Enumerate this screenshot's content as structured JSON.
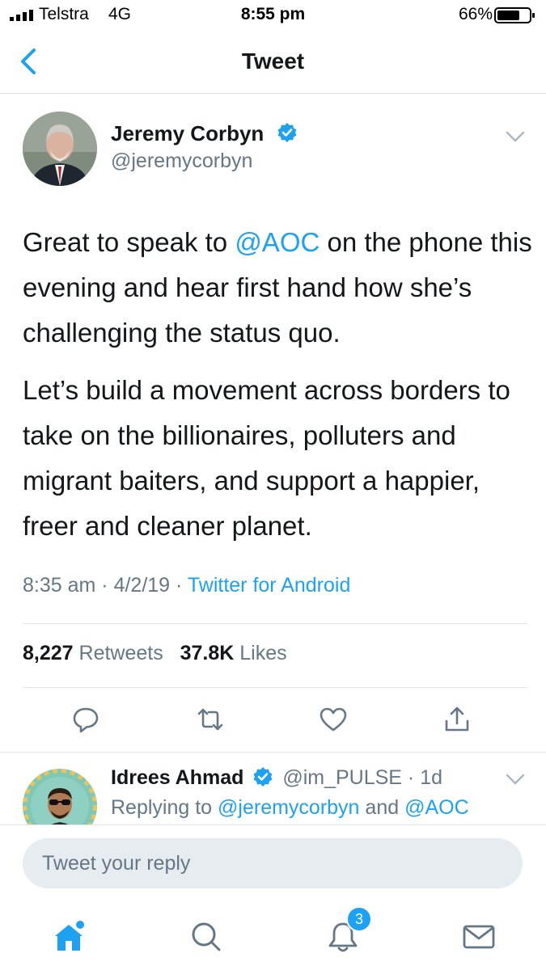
{
  "status_bar": {
    "carrier": "Telstra",
    "network": "4G",
    "time": "8:55 pm",
    "battery": "66%"
  },
  "header": {
    "title": "Tweet"
  },
  "tweet": {
    "author_name": "Jeremy Corbyn",
    "handle": "@jeremycorbyn",
    "paragraph1": {
      "before": "Great to speak to ",
      "mention": "@AOC",
      "after": " on the phone this evening and hear first hand how she’s challenging the status quo."
    },
    "paragraph2": "Let’s build a movement across borders to take on the billionaires, polluters and migrant baiters, and support a happier, freer and cleaner planet.",
    "time": "8:35 am",
    "date": "4/2/19",
    "source": "Twitter for Android",
    "retweets_count": "8,227",
    "retweets_label": "Retweets",
    "likes_count": "37.8K",
    "likes_label": "Likes"
  },
  "reply": {
    "name": "Idrees Ahmad",
    "handle": "@im_PULSE",
    "age": "1d",
    "replying_prefix": "Replying to ",
    "replying_to_1": "@jeremycorbyn",
    "replying_and": " and ",
    "replying_to_2": "@AOC"
  },
  "composer": {
    "placeholder": "Tweet your reply"
  },
  "tabbar": {
    "notifications_badge": "3"
  },
  "colors": {
    "accent": "#1da1f2",
    "secondary_text": "#657786",
    "primary_text": "#14171a",
    "input_bg": "#e6ecf0"
  },
  "icons": [
    "back-chevron-icon",
    "verified-badge-icon",
    "chevron-down-icon",
    "reply-icon",
    "retweet-icon",
    "like-heart-icon",
    "share-icon",
    "home-icon",
    "search-icon",
    "notifications-bell-icon",
    "messages-envelope-icon"
  ]
}
